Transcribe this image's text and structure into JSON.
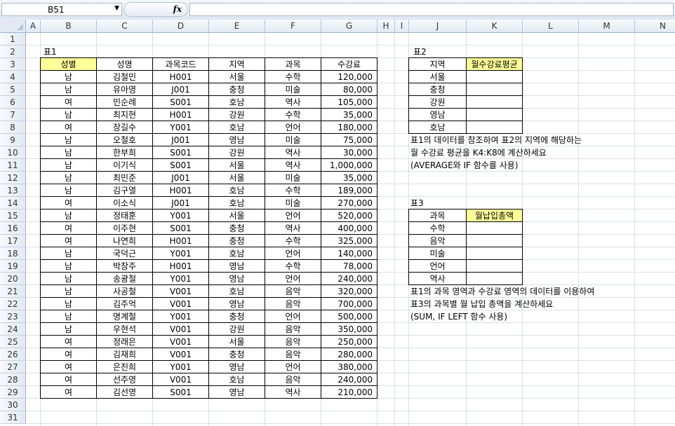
{
  "formula_bar": {
    "name_box": "B51",
    "fx": "fx"
  },
  "columns": [
    "A",
    "B",
    "C",
    "D",
    "E",
    "F",
    "G",
    "H",
    "I",
    "J",
    "K",
    "L",
    "M",
    "N"
  ],
  "rows": [
    "1",
    "2",
    "3",
    "4",
    "5",
    "6",
    "7",
    "8",
    "9",
    "10",
    "11",
    "12",
    "13",
    "14",
    "15",
    "16",
    "17",
    "18",
    "19",
    "20",
    "21",
    "22",
    "23",
    "24",
    "25",
    "26",
    "27",
    "28",
    "29",
    "30",
    "31"
  ],
  "table1": {
    "caption": "표1",
    "headers": [
      "성별",
      "성명",
      "과목코드",
      "지역",
      "과목",
      "수강료"
    ],
    "rows": [
      [
        "남",
        "김철민",
        "H001",
        "서울",
        "수학",
        "120,000"
      ],
      [
        "남",
        "유아영",
        "J001",
        "충청",
        "미술",
        "80,000"
      ],
      [
        "여",
        "민순례",
        "S001",
        "호남",
        "역사",
        "105,000"
      ],
      [
        "남",
        "최지현",
        "H001",
        "강원",
        "수학",
        "35,000"
      ],
      [
        "여",
        "장길수",
        "Y001",
        "호남",
        "언어",
        "180,000"
      ],
      [
        "남",
        "오철호",
        "J001",
        "영남",
        "미술",
        "75,000"
      ],
      [
        "남",
        "한부희",
        "S001",
        "강원",
        "역사",
        "30,000"
      ],
      [
        "남",
        "이기식",
        "S001",
        "서울",
        "역사",
        "1,000,000"
      ],
      [
        "남",
        "최민준",
        "J001",
        "서울",
        "미술",
        "35,000"
      ],
      [
        "남",
        "김구열",
        "H001",
        "호남",
        "수학",
        "189,000"
      ],
      [
        "여",
        "이소식",
        "J001",
        "호남",
        "미술",
        "270,000"
      ],
      [
        "남",
        "정태훈",
        "Y001",
        "서울",
        "언어",
        "520,000"
      ],
      [
        "여",
        "이주현",
        "S001",
        "충청",
        "역사",
        "400,000"
      ],
      [
        "여",
        "나연희",
        "H001",
        "충청",
        "수학",
        "325,000"
      ],
      [
        "남",
        "국덕근",
        "Y001",
        "호남",
        "언어",
        "140,000"
      ],
      [
        "남",
        "박창주",
        "H001",
        "영남",
        "수학",
        "78,000"
      ],
      [
        "남",
        "송광철",
        "Y001",
        "영남",
        "언어",
        "240,000"
      ],
      [
        "남",
        "사공철",
        "V001",
        "호남",
        "음악",
        "320,000"
      ],
      [
        "남",
        "김주억",
        "V001",
        "영남",
        "음악",
        "700,000"
      ],
      [
        "남",
        "명계철",
        "Y001",
        "충청",
        "언어",
        "500,000"
      ],
      [
        "남",
        "우현석",
        "V001",
        "강원",
        "음악",
        "350,000"
      ],
      [
        "여",
        "정래은",
        "V001",
        "서울",
        "음악",
        "250,000"
      ],
      [
        "여",
        "김재희",
        "V001",
        "충청",
        "음악",
        "280,000"
      ],
      [
        "여",
        "은진희",
        "Y001",
        "영남",
        "언어",
        "380,000"
      ],
      [
        "여",
        "선주영",
        "V001",
        "호남",
        "음악",
        "240,000"
      ],
      [
        "여",
        "김선영",
        "S001",
        "영남",
        "역사",
        "210,000"
      ]
    ]
  },
  "table2": {
    "caption": "표2",
    "headers": [
      "지역",
      "월수강료평균"
    ],
    "rows": [
      "서울",
      "충청",
      "강원",
      "영남",
      "호남"
    ],
    "notes": [
      "표1의 데이터를 참조하여 표2의 지역에 해당하는",
      "월 수강료 평균을 K4:K8에 계산하세요",
      "(AVERAGE와 IF 함수를 사용)"
    ]
  },
  "table3": {
    "caption": "표3",
    "headers": [
      "과목",
      "월납입총액"
    ],
    "rows": [
      "수학",
      "음악",
      "미술",
      "언어",
      "역사"
    ],
    "notes": [
      "표1의 과목 영역과 수강료 영역의 데이터를 이용하여",
      "표3의 과목별 월 납입 총액을 계산하세요",
      "(SUM, IF LEFT 함수 사용)"
    ]
  },
  "colors": {
    "highlight": "#ffff99",
    "header_bg": "#e2e9f3"
  }
}
